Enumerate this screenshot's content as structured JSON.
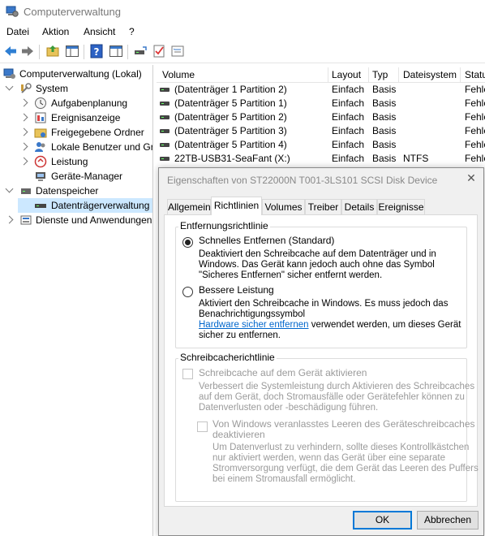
{
  "window": {
    "title": "Computerverwaltung"
  },
  "menu": [
    "Datei",
    "Aktion",
    "Ansicht",
    "?"
  ],
  "toolbar": {
    "icons": [
      "back-arrow-icon",
      "forward-arrow-icon",
      "folder-up-icon",
      "show-hide-tree-icon",
      "help-icon",
      "show-hide-action-pane-icon",
      "disk-connect-icon",
      "check-icon",
      "properties-icon"
    ]
  },
  "tree": {
    "items": [
      {
        "label": "Computerverwaltung (Lokal)"
      },
      {
        "label": "System"
      },
      {
        "label": "Aufgabenplanung"
      },
      {
        "label": "Ereignisanzeige"
      },
      {
        "label": "Freigegebene Ordner"
      },
      {
        "label": "Lokale Benutzer und Gruppen"
      },
      {
        "label": "Leistung"
      },
      {
        "label": "Geräte-Manager"
      },
      {
        "label": "Datenspeicher"
      },
      {
        "label": "Datenträgerverwaltung"
      },
      {
        "label": "Dienste und Anwendungen"
      }
    ]
  },
  "volumes": {
    "columns": [
      "Volume",
      "Layout",
      "Typ",
      "Dateisystem",
      "Status"
    ],
    "rows": [
      {
        "volume": "(Datenträger 1 Partition 2)",
        "layout": "Einfach",
        "typ": "Basis",
        "fs": "",
        "status": "Fehlerfrei"
      },
      {
        "volume": "(Datenträger 5 Partition 1)",
        "layout": "Einfach",
        "typ": "Basis",
        "fs": "",
        "status": "Fehlerfrei"
      },
      {
        "volume": "(Datenträger 5 Partition 2)",
        "layout": "Einfach",
        "typ": "Basis",
        "fs": "",
        "status": "Fehlerfrei"
      },
      {
        "volume": "(Datenträger 5 Partition 3)",
        "layout": "Einfach",
        "typ": "Basis",
        "fs": "",
        "status": "Fehlerfrei"
      },
      {
        "volume": "(Datenträger 5 Partition 4)",
        "layout": "Einfach",
        "typ": "Basis",
        "fs": "",
        "status": "Fehlerfrei"
      },
      {
        "volume": "22TB-USB31-SeaFant (X:)",
        "layout": "Einfach",
        "typ": "Basis",
        "fs": "NTFS",
        "status": "Fehlerfrei"
      }
    ]
  },
  "dialog": {
    "title": "Eigenschaften von ST22000N T001-3LS101 SCSI Disk Device",
    "tabs": [
      "Allgemein",
      "Richtlinien",
      "Volumes",
      "Treiber",
      "Details",
      "Ereignisse"
    ],
    "active_tab": "Richtlinien",
    "removal_group": {
      "title": "Entfernungsrichtlinie",
      "quick": {
        "label": "Schnelles Entfernen (Standard)",
        "selected": true,
        "desc": [
          "Deaktiviert den Schreibcache auf dem Datenträger und in",
          "Windows. Das Gerät kann jedoch auch ohne das Symbol",
          "\"Sicheres Entfernen\" sicher entfernt werden."
        ]
      },
      "perf": {
        "label": "Bessere Leistung",
        "selected": false,
        "desc_1": "Aktiviert den Schreibcache in Windows. Es muss jedoch das",
        "desc_2": "Benachrichtigungssymbol",
        "link": "Hardware sicher entfernen",
        "desc_3": " verwendet werden, um dieses Gerät",
        "desc_4": "sicher zu entfernen."
      }
    },
    "cache_group": {
      "title": "Schreibcacherichtlinie",
      "enable": {
        "label": "Schreibcache auf dem Gerät aktivieren",
        "checked": false,
        "desc": [
          "Verbessert die Systemleistung durch Aktivieren des Schreibcaches",
          "auf dem Gerät, doch Stromausfälle oder Gerätefehler können zu",
          "Datenverlusten oder -beschädigung führen."
        ]
      },
      "flush": {
        "label": [
          "Von Windows veranlasstes Leeren des Geräteschreibcaches",
          "deaktivieren"
        ],
        "checked": false,
        "desc": [
          "Um Datenverlust zu verhindern, sollte dieses Kontrollkästchen",
          "nur aktiviert werden, wenn das Gerät über eine separate",
          "Stromversorgung verfügt, die dem Gerät das Leeren des Puffers",
          "bei einem Stromausfall ermöglicht."
        ]
      }
    },
    "buttons": {
      "ok": "OK",
      "cancel": "Abbrechen"
    }
  }
}
